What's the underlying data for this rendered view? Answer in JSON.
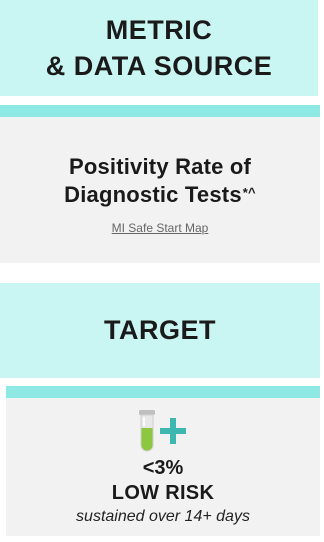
{
  "header": {
    "line1": "METRIC",
    "line2": "& DATA SOURCE"
  },
  "metric": {
    "title_line1": "Positivity Rate of",
    "title_line2": "Diagnostic Tests",
    "title_marks": "*^",
    "source_link": "MI Safe Start Map"
  },
  "target": {
    "label": "TARGET"
  },
  "goal": {
    "value": "<3%",
    "risk_level": "LOW RISK",
    "duration": "sustained over 14+ days",
    "icons": [
      "test-tube-icon",
      "plus-icon"
    ]
  },
  "colors": {
    "aqua": "#c9f5f2",
    "stripe": "#8ee8e3",
    "gray": "#f2f2f2",
    "tube_green": "#8dc63f",
    "plus_teal": "#3fb7b1"
  }
}
